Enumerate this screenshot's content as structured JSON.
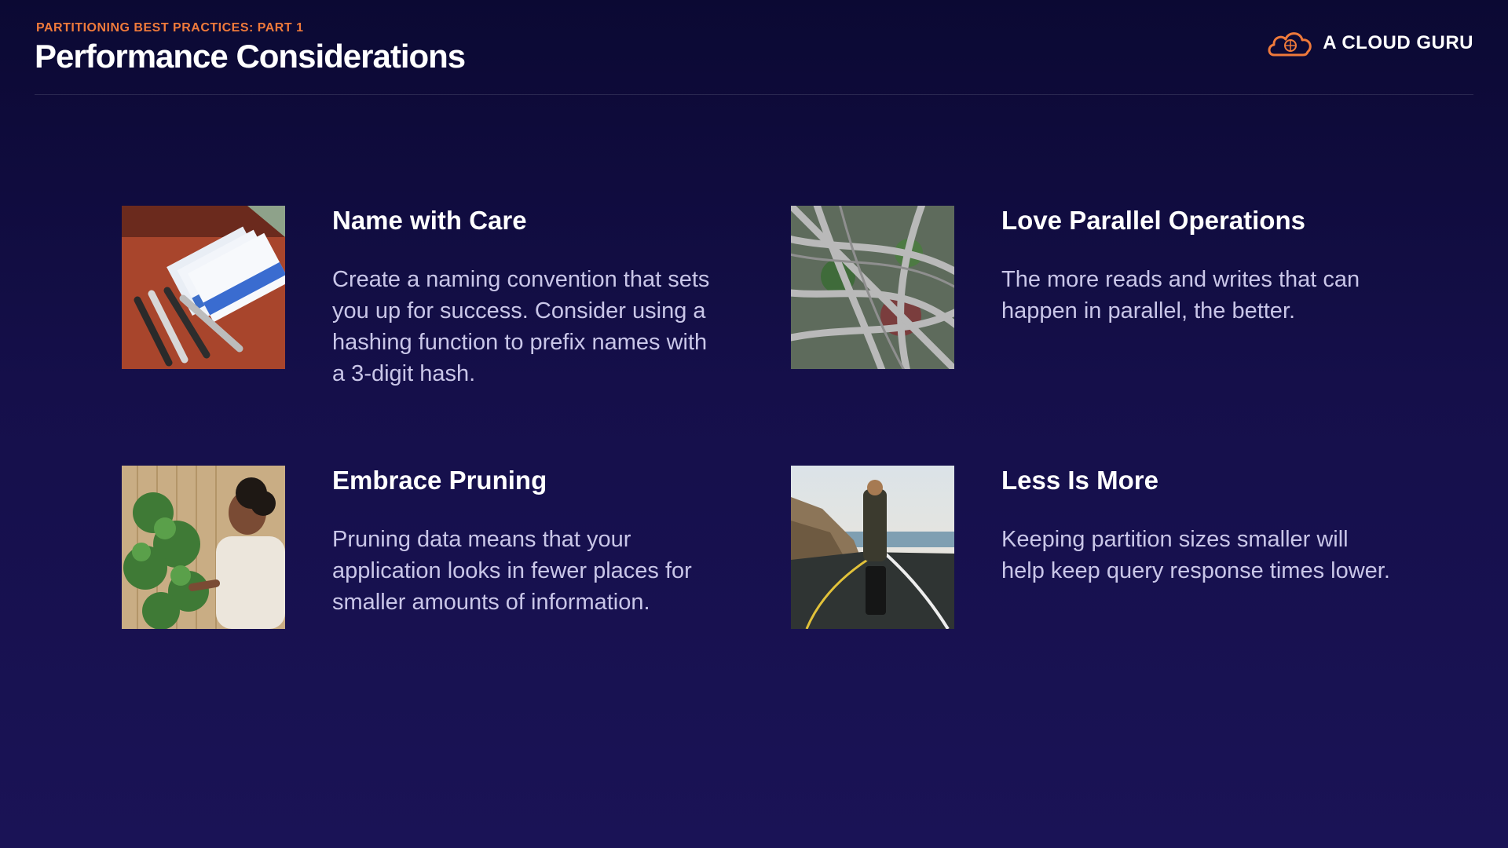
{
  "header": {
    "eyebrow": "PARTITIONING BEST PRACTICES: PART 1",
    "title": "Performance Considerations",
    "brand": "A CLOUD GURU",
    "brand_color": "#ef7a3b"
  },
  "cards": [
    {
      "title": "Name with Care",
      "text": "Create a naming convention that sets you up for success. Consider using a hashing function to prefix names with a 3-digit hash.",
      "image": "name-tags-photo"
    },
    {
      "title": "Love Parallel Operations",
      "text": "The more reads and writes that can happen in parallel, the better.",
      "image": "highway-interchange-photo"
    },
    {
      "title": "Embrace Pruning",
      "text": "Pruning data means that your application looks in fewer places for smaller amounts of information.",
      "image": "woman-pruning-plant-photo"
    },
    {
      "title": "Less Is More",
      "text": "Keeping partition sizes smaller will help keep query response times lower.",
      "image": "traveler-on-road-photo"
    }
  ]
}
